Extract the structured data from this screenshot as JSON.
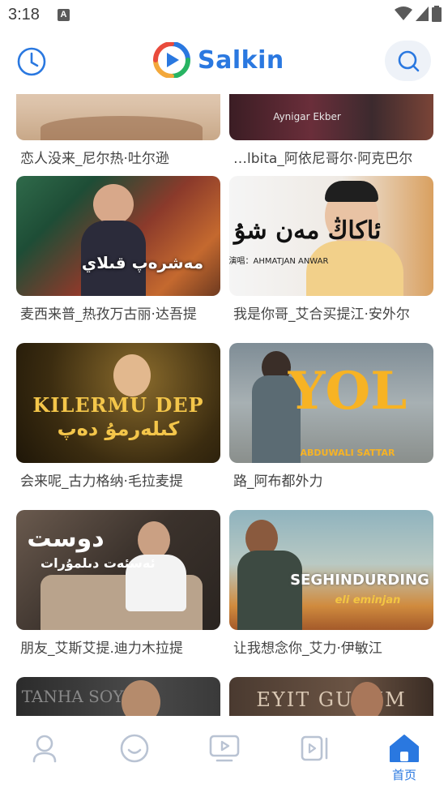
{
  "status": {
    "time": "3:18",
    "notification_letter": "A"
  },
  "header": {
    "app_name": "Salkin"
  },
  "videos": [
    {
      "title": "恋人没来_尼尔热·吐尔逊",
      "overlay": ""
    },
    {
      "title": "…lbita_阿依尼哥尔·阿克巴尔",
      "overlay": "Aynigar Ekber"
    },
    {
      "title": "麦西来普_热孜万古丽·达吾提",
      "overlay": "مەشرەپ قىلاي"
    },
    {
      "title": "我是你哥_艾合买提江·安外尔",
      "overlay": "演唱：AHMATJAN ANWAR"
    },
    {
      "title": "会来呢_古力格纳·毛拉麦提",
      "overlay": "KILERMU DEP"
    },
    {
      "title": "路_阿布都外力",
      "overlay": "YOL",
      "overlay2": "ABDUWALI SATTAR"
    },
    {
      "title": "朋友_艾斯艾提.迪力木拉提",
      "overlay": "دوست"
    },
    {
      "title": "让我想念你_艾力·伊敏江",
      "overlay": "SEGHINDURDING",
      "overlay2": "eli eminjan"
    },
    {
      "title": "",
      "overlay": "TANHA SOYGU"
    },
    {
      "title": "",
      "overlay": "EYIT GULUM"
    }
  ],
  "nav": [
    {
      "name": "profile",
      "label": ""
    },
    {
      "name": "emoji",
      "label": ""
    },
    {
      "name": "video",
      "label": ""
    },
    {
      "name": "shorts",
      "label": ""
    },
    {
      "name": "home",
      "label": "首页",
      "active": true
    }
  ],
  "colors": {
    "accent": "#2a78e0",
    "icon_gray": "#b9c3d3"
  }
}
